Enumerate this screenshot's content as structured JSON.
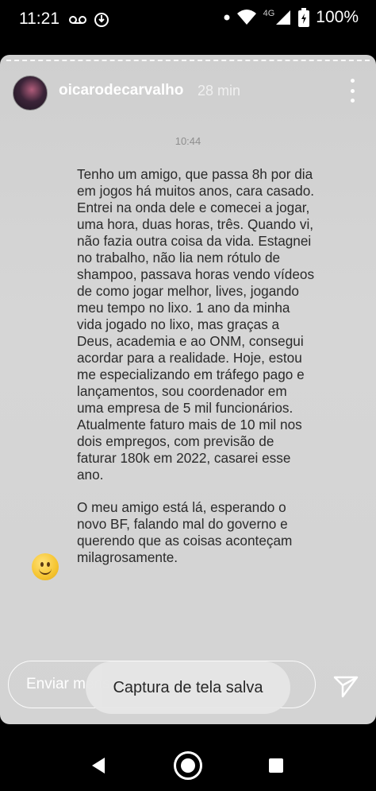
{
  "status_bar": {
    "time": "11:21",
    "network": "4G",
    "battery": "100%",
    "icons": [
      "voicemail-icon",
      "media-icon",
      "dot-icon",
      "wifi-icon",
      "signal-icon",
      "battery-icon"
    ]
  },
  "story": {
    "username": "oicarodecarvalho",
    "posted": "28 min",
    "message_time": "10:44",
    "paragraphs": [
      "Tenho um amigo, que passa 8h por dia em jogos há muitos anos, cara casado. Entrei na onda dele e comecei a jogar, uma hora, duas horas, três. Quando vi, não fazia outra coisa da vida. Estagnei no trabalho, não lia nem rótulo de shampoo, passava horas vendo vídeos de como jogar melhor, lives, jogando meu tempo no lixo. 1 ano da minha vida jogado no lixo, mas graças a Deus, academia e ao ONM, consegui acordar para a realidade. Hoje, estou me especializando em tráfego pago e lançamentos, sou coordenador em uma empresa de 5 mil funcionários. Atualmente faturo mais de 10 mil nos dois empregos, com previsão de faturar 180k em 2022, casarei esse ano.",
      "O meu amigo está lá, esperando o novo BF, falando mal do governo e querendo que as coisas aconteçam milagrosamente."
    ]
  },
  "reply": {
    "placeholder": "Enviar mensagem"
  },
  "toast": {
    "text": "Captura de tela salva"
  },
  "colors": {
    "story_bg": "#d3d3d3",
    "text": "#2a2a2a",
    "toast_bg": "#e6e6e6"
  }
}
